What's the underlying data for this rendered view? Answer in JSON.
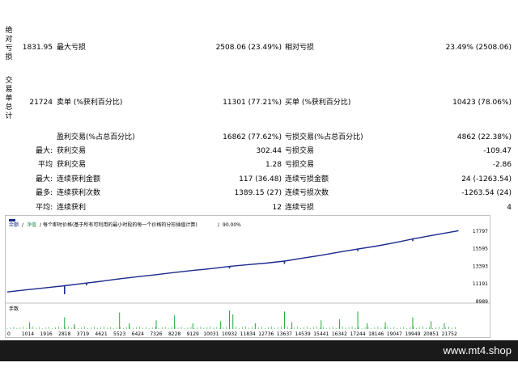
{
  "side_labels": {
    "absolute": "绝对亏损",
    "trades": "交易单总计"
  },
  "rows": {
    "r1": {
      "v1": "1831.95",
      "l2": "最大亏损",
      "v2": "2508.06 (23.49%)",
      "l3": "相对亏损",
      "v3": "23.49% (2508.06)"
    },
    "r2": {
      "v1": "21724",
      "l2": "卖单 (%获利百分比)",
      "v2": "11301 (77.21%)",
      "l3": "买单 (%获利百分比)",
      "v3": "10423 (78.06%)"
    },
    "r3": {
      "l2": "盈利交易(%占总百分比)",
      "v2": "16862 (77.62%)",
      "l3": "亏损交易(%占总百分比)",
      "v3": "4862 (22.38%)"
    },
    "r4": {
      "pre": "最大:",
      "l2": "获利交易",
      "v2": "302.44",
      "l3": "亏损交易",
      "v3": "-109.47"
    },
    "r5": {
      "pre": "平均",
      "l2": "获利交易",
      "v2": "1.28",
      "l3": "亏损交易",
      "v3": "-2.86"
    },
    "r6": {
      "pre": "最大:",
      "l2": "连续获利金额",
      "v2": "117 (36.48)",
      "l3": "连续亏损金额",
      "v3": "24 (-1263.54)"
    },
    "r7": {
      "pre": "最多:",
      "l2": "连续获利次数",
      "v2": "1389.15 (27)",
      "l3": "连续亏损次数",
      "v3": "-1263.54 (24)"
    },
    "r8": {
      "pre": "平均:",
      "l2": "连续获利",
      "v2": "12",
      "l3": "连续亏损",
      "v3": "4"
    }
  },
  "chart_legend": {
    "balance": "余额",
    "equity": "净值",
    "desc": "每个即时价格(基于所有可利用的最小时段的每一个价格的分形插值计算)",
    "quality": "90.00%"
  },
  "volume_label": "手数",
  "brand": "www.mt4.shop",
  "colors": {
    "balance": "#1a2a8c",
    "equity": "#2e8b57",
    "volume": "#1faa3a"
  },
  "chart_data": {
    "type": "line",
    "x_ticks": [
      "0",
      "1014",
      "1916",
      "2818",
      "3719",
      "4621",
      "5523",
      "6424",
      "7326",
      "8228",
      "9129",
      "10031",
      "10932",
      "11834",
      "12736",
      "13637",
      "14539",
      "15441",
      "16342",
      "17244",
      "18146",
      "19047",
      "19949",
      "20851",
      "21752"
    ],
    "y_ticks": [
      17797,
      15595,
      13393,
      11191,
      8989
    ],
    "ylim": [
      8989,
      18300
    ],
    "xlim": [
      0,
      22300
    ],
    "series": [
      {
        "name": "余额",
        "x": [
          0,
          1014,
          1916,
          2818,
          3719,
          4621,
          5523,
          6424,
          7326,
          8228,
          9129,
          10031,
          10932,
          11834,
          12736,
          13637,
          14539,
          15441,
          16342,
          17244,
          18146,
          19047,
          19949,
          20851,
          21752,
          22200
        ],
        "y": [
          10180,
          10480,
          10720,
          10960,
          11250,
          11520,
          11830,
          12100,
          12350,
          12620,
          12880,
          13110,
          13380,
          13600,
          13800,
          14050,
          14420,
          14780,
          15180,
          15560,
          15920,
          16350,
          16820,
          17250,
          17650,
          17850
        ]
      }
    ],
    "dips": [
      {
        "x": 2818,
        "y": 9900
      },
      {
        "x": 3900,
        "y": 11000
      },
      {
        "x": 5500,
        "y": 11750
      },
      {
        "x": 10932,
        "y": 13120
      },
      {
        "x": 13637,
        "y": 13700
      },
      {
        "x": 17244,
        "y": 15300
      },
      {
        "x": 19949,
        "y": 16550
      }
    ],
    "volume_spikes": [
      {
        "x": 1100,
        "h": 0.35
      },
      {
        "x": 2818,
        "h": 0.6
      },
      {
        "x": 3300,
        "h": 0.25
      },
      {
        "x": 5523,
        "h": 0.85
      },
      {
        "x": 6000,
        "h": 0.3
      },
      {
        "x": 7326,
        "h": 0.45
      },
      {
        "x": 8228,
        "h": 0.7
      },
      {
        "x": 9129,
        "h": 0.3
      },
      {
        "x": 10500,
        "h": 0.4
      },
      {
        "x": 10932,
        "h": 0.95
      },
      {
        "x": 11100,
        "h": 0.75
      },
      {
        "x": 12200,
        "h": 0.3
      },
      {
        "x": 13637,
        "h": 0.9
      },
      {
        "x": 14000,
        "h": 0.35
      },
      {
        "x": 15441,
        "h": 0.45
      },
      {
        "x": 16342,
        "h": 0.5
      },
      {
        "x": 17244,
        "h": 0.9
      },
      {
        "x": 17700,
        "h": 0.3
      },
      {
        "x": 18600,
        "h": 0.35
      },
      {
        "x": 19949,
        "h": 0.6
      },
      {
        "x": 20851,
        "h": 0.4
      },
      {
        "x": 21500,
        "h": 0.3
      }
    ]
  }
}
